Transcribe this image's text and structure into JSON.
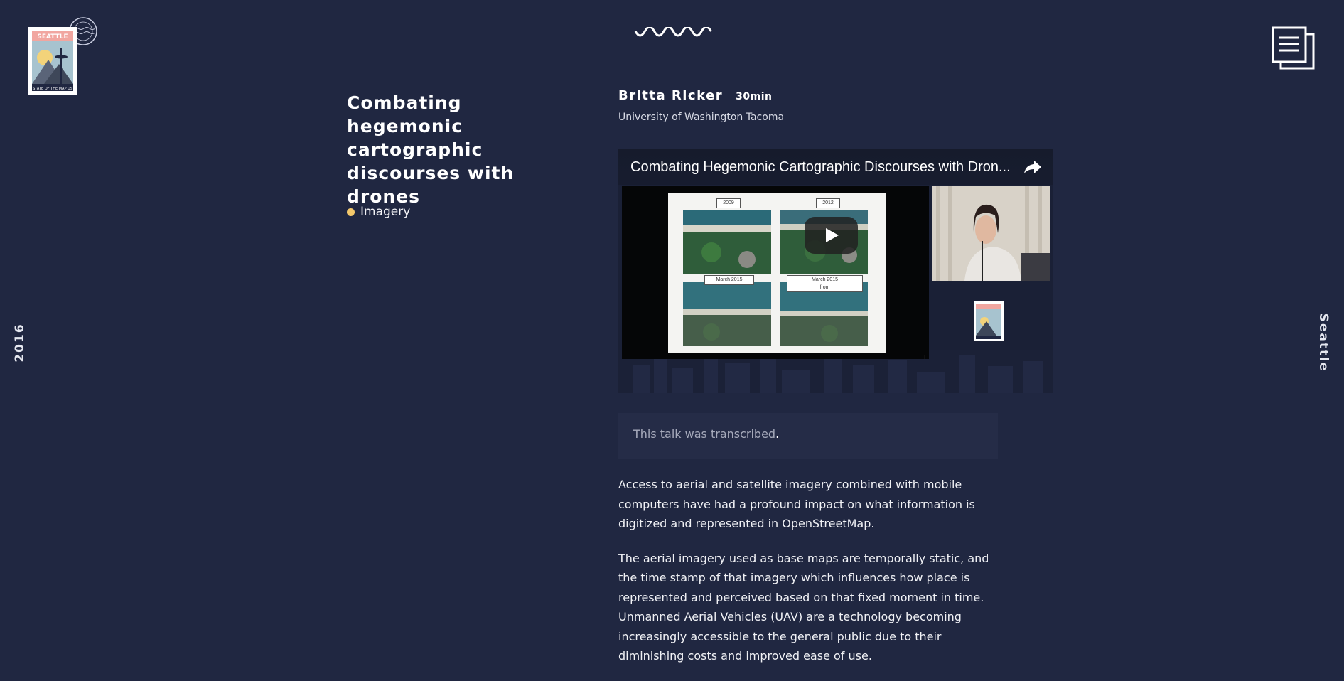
{
  "header": {
    "logo": {
      "name": "State of the Map US Seattle stamp logo",
      "stamp_top_text": "SEATTLE",
      "stamp_bottom_text": "STATE OF THE MAP US"
    },
    "wave_icon": "wave-divider-icon",
    "menu_icon": "stacked-documents-menu-icon"
  },
  "side": {
    "year": "2016",
    "city": "Seattle"
  },
  "talk": {
    "title": "Combating hegemonic cartographic discourses with drones",
    "tags": [
      {
        "label": "Imagery",
        "color": "#f3c86b"
      }
    ]
  },
  "speaker": {
    "name": "Britta Ricker",
    "duration": "30min",
    "affiliation": "University of Washington Tacoma"
  },
  "video": {
    "title": "Combating Hegemonic Cartographic Discourses with Dron...",
    "share_icon": "share-arrow-icon",
    "play_icon": "play-icon",
    "slide_labels": [
      "2009",
      "2012",
      "March 2015",
      "March 2015"
    ],
    "slide_caption": "from"
  },
  "transcript_notice": {
    "link_text": "This talk was transcribed",
    "suffix": "."
  },
  "description": [
    "Access to aerial and satellite imagery combined with mobile computers have had a profound impact on what information is digitized and represented in OpenStreetMap.",
    "The aerial imagery used as base maps are temporally static, and the time stamp of that imagery which influences how place is represented and perceived based on that fixed moment in time. Unmanned Aerial Vehicles (UAV) are a technology becoming increasingly accessible to the general public due to their diminishing costs and improved ease of use."
  ],
  "colors": {
    "background": "#202741",
    "notice_bg": "#252c47",
    "tag_dot": "#f3c86b",
    "stamp_pink": "#f1a6a0",
    "stamp_sun": "#f3d37a"
  }
}
